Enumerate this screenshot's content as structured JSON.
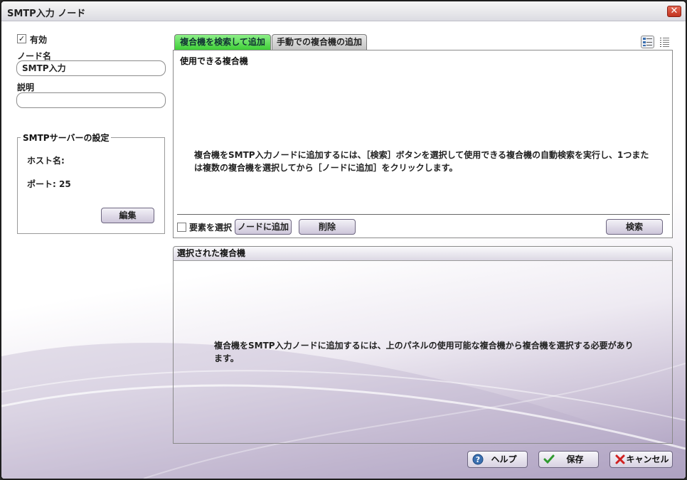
{
  "window": {
    "title": "SMTP入力 ノード"
  },
  "left": {
    "enabled_label": "有効",
    "enabled_checked": true,
    "node_name_label": "ノード名",
    "node_name_value": "SMTP入力",
    "description_label": "説明",
    "description_value": "",
    "smtp_group": {
      "title": "SMTPサーバーの設定",
      "host_label": "ホスト名:",
      "port_label": "ポート: 25",
      "edit_button": "編集"
    }
  },
  "tabs": [
    {
      "label": "複合機を検索して追加",
      "active": true
    },
    {
      "label": "手動での複合機の追加",
      "active": false
    }
  ],
  "view_icons": [
    "detail-view-icon",
    "list-view-icon"
  ],
  "available_panel": {
    "header": "使用できる複合機",
    "message_line1": "複合機をSMTP入力ノードに追加するには、［検索］ボタンを選択して使用できる複合機の自動検索を実行し、1つまた",
    "message_line2": "は複数の複合機を選択してから［ノードに追加］をクリックします。",
    "select_all_label": "要素を選択",
    "add_to_node_button": "ノードに追加",
    "delete_button": "削除",
    "search_button": "検索"
  },
  "selected_panel": {
    "header": "選択された複合機",
    "message_line1": "複合機をSMTP入力ノードに追加するには、上のパネルの使用可能な複合機から複合機を選択する必要があり",
    "message_line2": "ます。"
  },
  "footer": {
    "help_button": "ヘルプ",
    "save_button": "保存",
    "cancel_button": "キャンセル"
  },
  "colors": {
    "active_tab": "#3fcf37",
    "accent_purple": "#a89bbd",
    "help_icon": "#3a6fb0",
    "save_icon": "#2f9a2f",
    "cancel_icon": "#d02020"
  }
}
